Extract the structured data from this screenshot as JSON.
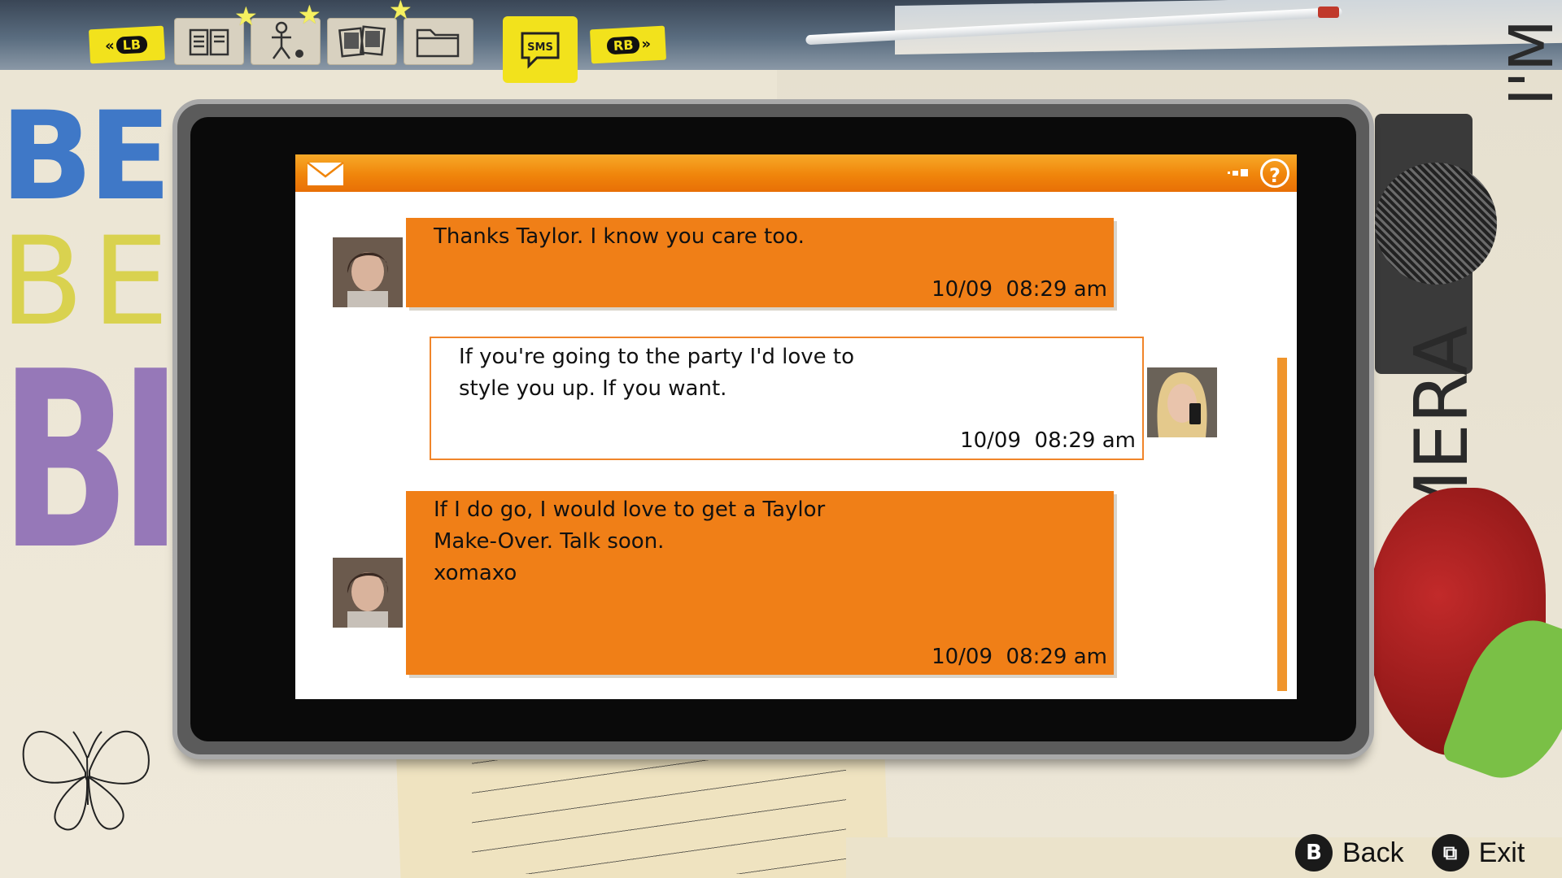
{
  "background": {
    "left_words": [
      "BE",
      "BE",
      "BI"
    ],
    "right_text": "I'M A LIAR, A MAGICIAN",
    "right_text_2": "CAMERA",
    "colors": {
      "blue_word": "#3f78c7",
      "yellow_word": "#d9d24f",
      "purple_word": "#9678b8"
    }
  },
  "tabs": {
    "prev_label": "LB",
    "next_label": "RB",
    "items": [
      {
        "name": "journal",
        "icon": "book-icon",
        "active": false
      },
      {
        "name": "characters",
        "icon": "stick-figure-icon",
        "active": false
      },
      {
        "name": "photos",
        "icon": "photos-icon",
        "active": false
      },
      {
        "name": "files",
        "icon": "folder-icon",
        "active": false
      },
      {
        "name": "sms",
        "label": "SMS",
        "icon": "sms-bubble-icon",
        "active": true
      }
    ]
  },
  "screen": {
    "header_icons": [
      "envelope-icon",
      "signal-icon",
      "help-icon"
    ],
    "help_label": "?",
    "accent_color": "#f07f17"
  },
  "messages": [
    {
      "direction": "outgoing",
      "sender_avatar": "max-avatar",
      "text": "Thanks Taylor. I know you care too.",
      "timestamp": "10/09  08:29 am"
    },
    {
      "direction": "incoming",
      "sender_avatar": "taylor-avatar",
      "text": "If you're going to the party I'd love to\nstyle you up. If you want.",
      "timestamp": "10/09  08:29 am"
    },
    {
      "direction": "outgoing",
      "sender_avatar": "max-avatar",
      "text": "If I do go, I would love to get a Taylor\nMake-Over. Talk soon.\nxomaxo",
      "timestamp": "10/09  08:29 am"
    }
  ],
  "hints": [
    {
      "button": "B",
      "label": "Back"
    },
    {
      "button": "⧉",
      "label": "Exit"
    }
  ]
}
